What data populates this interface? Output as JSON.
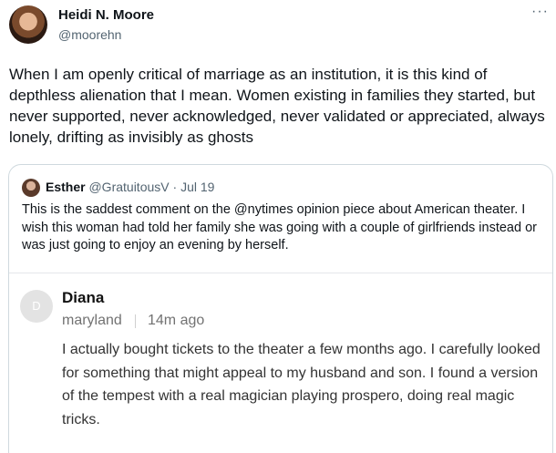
{
  "tweet": {
    "author_name": "Heidi N. Moore",
    "author_handle": "@moorehn",
    "more_icon": "more-horizontal-icon",
    "more_glyph": "···",
    "text": "When I am openly critical of marriage as an institution, it is this kind of depthless alienation that I mean. Women existing in families they started, but never supported, never acknowledged, never validated or appreciated, always lonely, drifting as invisibly as ghosts"
  },
  "quote": {
    "author_name": "Esther",
    "author_handle": "@GratuitousV",
    "separator": "·",
    "date": "Jul 19",
    "text": "This is the saddest comment on the @nytimes opinion piece about American theater. I wish this woman had told her family she was going with a couple of girlfriends instead or was just going to enjoy an evening by herself.",
    "comment": {
      "avatar_initial": "D",
      "name": "Diana",
      "location": "maryland",
      "time": "14m ago",
      "text": "I actually bought tickets to the theater a few months ago.  I carefully looked for something that might appeal to my husband and son.  I found a version of the tempest with a real magician playing prospero, doing real magic tricks."
    }
  },
  "colors": {
    "text_primary": "#0f1419",
    "text_secondary": "#536471",
    "card_border": "#cfd9de",
    "comment_text": "#333333",
    "comment_meta": "#727272"
  }
}
